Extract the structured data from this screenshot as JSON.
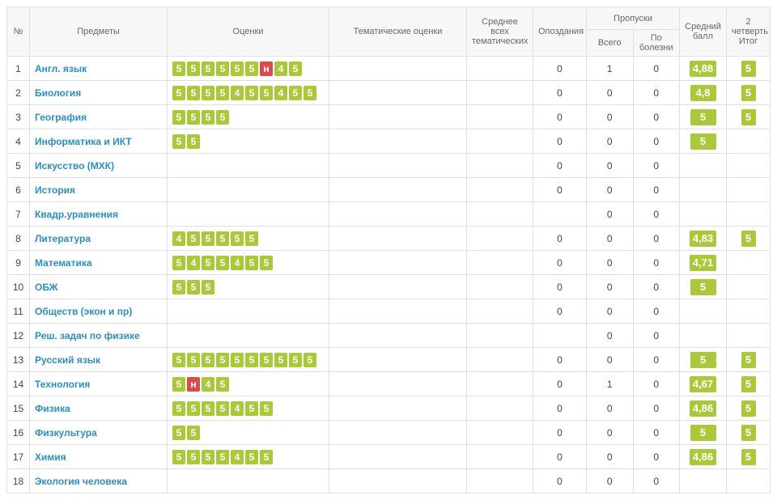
{
  "headers": {
    "num": "№",
    "subject": "Предметы",
    "grades": "Оценки",
    "thematic_grades": "Тематические оценки",
    "avg_thematic": "Среднее всех тематических",
    "late": "Опоздания",
    "absences": "Пропуски",
    "abs_total": "Всего",
    "abs_ill": "По болезни",
    "avg_score": "Средний балл",
    "quarter": "2 четверть Итог"
  },
  "rows": [
    {
      "num": "1",
      "subject": "Англ. язык",
      "grades": [
        "5",
        "5",
        "5",
        "5",
        "5",
        "5",
        "н",
        "4",
        "5"
      ],
      "late": "0",
      "abs_total": "1",
      "abs_ill": "0",
      "avg": "4,88",
      "quarter": "5"
    },
    {
      "num": "2",
      "subject": "Биология",
      "grades": [
        "5",
        "5",
        "5",
        "5",
        "4",
        "5",
        "5",
        "4",
        "5",
        "5"
      ],
      "late": "0",
      "abs_total": "0",
      "abs_ill": "0",
      "avg": "4,8",
      "quarter": "5"
    },
    {
      "num": "3",
      "subject": "География",
      "grades": [
        "5",
        "5",
        "5",
        "5"
      ],
      "late": "0",
      "abs_total": "0",
      "abs_ill": "0",
      "avg": "5",
      "quarter": "5"
    },
    {
      "num": "4",
      "subject": "Информатика и ИКТ",
      "grades": [
        "5",
        "5"
      ],
      "late": "0",
      "abs_total": "0",
      "abs_ill": "0",
      "avg": "5",
      "quarter": ""
    },
    {
      "num": "5",
      "subject": "Искусство (МХК)",
      "grades": [],
      "late": "0",
      "abs_total": "0",
      "abs_ill": "0",
      "avg": "",
      "quarter": ""
    },
    {
      "num": "6",
      "subject": "История",
      "grades": [],
      "late": "0",
      "abs_total": "0",
      "abs_ill": "0",
      "avg": "",
      "quarter": ""
    },
    {
      "num": "7",
      "subject": "Квадр.уравнения",
      "grades": [],
      "late": "",
      "abs_total": "0",
      "abs_ill": "0",
      "avg": "",
      "quarter": ""
    },
    {
      "num": "8",
      "subject": "Литература",
      "grades": [
        "4",
        "5",
        "5",
        "5",
        "5",
        "5"
      ],
      "late": "0",
      "abs_total": "0",
      "abs_ill": "0",
      "avg": "4,83",
      "quarter": "5"
    },
    {
      "num": "9",
      "subject": "Математика",
      "grades": [
        "5",
        "4",
        "5",
        "5",
        "4",
        "5",
        "5"
      ],
      "late": "0",
      "abs_total": "0",
      "abs_ill": "0",
      "avg": "4,71",
      "quarter": ""
    },
    {
      "num": "10",
      "subject": "ОБЖ",
      "grades": [
        "5",
        "5",
        "5"
      ],
      "late": "0",
      "abs_total": "0",
      "abs_ill": "0",
      "avg": "5",
      "quarter": ""
    },
    {
      "num": "11",
      "subject": "Обществ (экон и пр)",
      "grades": [],
      "late": "0",
      "abs_total": "0",
      "abs_ill": "0",
      "avg": "",
      "quarter": ""
    },
    {
      "num": "12",
      "subject": "Реш. задач по физике",
      "grades": [],
      "late": "",
      "abs_total": "0",
      "abs_ill": "0",
      "avg": "",
      "quarter": ""
    },
    {
      "num": "13",
      "subject": "Русский язык",
      "grades": [
        "5",
        "5",
        "5",
        "5",
        "5",
        "5",
        "5",
        "5",
        "5",
        "5"
      ],
      "late": "0",
      "abs_total": "0",
      "abs_ill": "0",
      "avg": "5",
      "quarter": "5"
    },
    {
      "num": "14",
      "subject": "Технология",
      "grades": [
        "5",
        "н",
        "4",
        "5"
      ],
      "late": "0",
      "abs_total": "1",
      "abs_ill": "0",
      "avg": "4,67",
      "quarter": "5"
    },
    {
      "num": "15",
      "subject": "Физика",
      "grades": [
        "5",
        "5",
        "5",
        "5",
        "4",
        "5",
        "5"
      ],
      "late": "0",
      "abs_total": "0",
      "abs_ill": "0",
      "avg": "4,86",
      "quarter": "5"
    },
    {
      "num": "16",
      "subject": "Физкультура",
      "grades": [
        "5",
        "5"
      ],
      "late": "0",
      "abs_total": "0",
      "abs_ill": "0",
      "avg": "5",
      "quarter": "5"
    },
    {
      "num": "17",
      "subject": "Химия",
      "grades": [
        "5",
        "5",
        "5",
        "5",
        "4",
        "5",
        "5"
      ],
      "late": "0",
      "abs_total": "0",
      "abs_ill": "0",
      "avg": "4,86",
      "quarter": "5"
    },
    {
      "num": "18",
      "subject": "Экология человека",
      "grades": [],
      "late": "0",
      "abs_total": "0",
      "abs_ill": "0",
      "avg": "",
      "quarter": ""
    }
  ]
}
